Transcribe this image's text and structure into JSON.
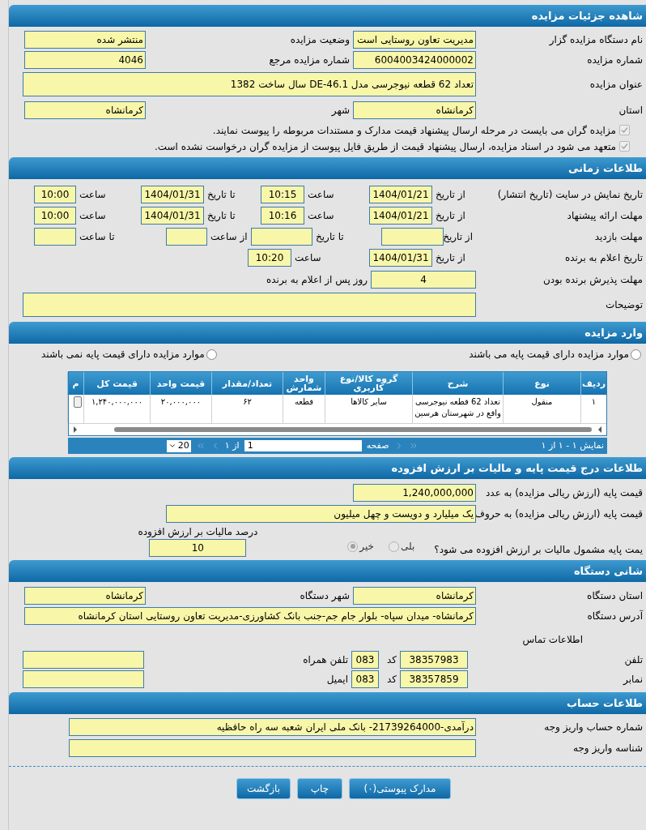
{
  "details": {
    "title": "شاهده جزئیات مزایده",
    "pairs": [
      [
        {
          "label": "نام دستگاه مزایده گزار",
          "value": "مدیریت تعاون روستایی است"
        },
        {
          "label": "وضعیت مزایده",
          "value": "منتشر شده"
        }
      ],
      [
        {
          "label": "شماره مزایده",
          "value": "6004003424000002"
        },
        {
          "label": "شماره مزایده مرجع",
          "value": "4046"
        }
      ]
    ],
    "subject": {
      "label": "عنوان مزایده",
      "value": "تعداد 62 قطعه نیوجرسی مدل DE-46.1  سال ساخت 1382"
    },
    "location": [
      {
        "label": "استان",
        "value": "کرمانشاه"
      },
      {
        "label": "شهر",
        "value": "کرمانشاه"
      }
    ],
    "notices": [
      {
        "text": "مزایده گران می بایست در مرحله ارسال پیشنهاد قیمت مدارک و مستندات مربوطه را پیوست نمایند.",
        "checked": true,
        "disabled": true
      },
      {
        "text": "متعهد می شود در اسناد مزایده، ارسال پیشنهاد قیمت از طریق فایل پیوست از مزایده گران درخواست نشده است.",
        "checked": true,
        "disabled": true
      }
    ]
  },
  "timing": {
    "title": "طلاعات زمانی",
    "rows": [
      {
        "label": "تاریخ نمایش در سایت (تاریخ انتشار)",
        "cells": [
          {
            "label": "از تاریخ",
            "value": "1404/01/21"
          },
          {
            "label": "ساعت",
            "value": "10:15"
          },
          {
            "label": "تا تاریخ",
            "value": "1404/01/31"
          },
          {
            "label": "ساعت",
            "value": "10:00"
          }
        ]
      },
      {
        "label": "مهلت ارائه پیشنهاد",
        "cells": [
          {
            "label": "از تاریخ",
            "value": "1404/01/21"
          },
          {
            "label": "ساعت",
            "value": "10:16"
          },
          {
            "label": "تا تاریخ",
            "value": "1404/01/31"
          },
          {
            "label": "ساعت",
            "value": "10:00"
          }
        ]
      },
      {
        "label": "مهلت بازدید",
        "cells": [
          {
            "label": "از تاریخ"
          },
          {
            "label": "تا تاریخ"
          },
          {
            "label": "از ساعت"
          },
          {
            "label": "تا ساعت"
          }
        ]
      },
      {
        "label": "تاریخ اعلام به برنده",
        "cells": [
          {
            "label": "از تاریخ",
            "value": "1404/01/31"
          },
          {
            "label": "ساعت",
            "value": "10:20"
          }
        ]
      }
    ],
    "acceptance": {
      "label": "مهلت پذیرش برنده بودن",
      "value": "4",
      "suffix": "روز پس از اعلام به برنده"
    },
    "notes": {
      "label": "توضیحات"
    }
  },
  "items": {
    "title": "وارد مزایده",
    "filters": [
      {
        "label": "موارد مزایده دارای قیمت پایه می باشند",
        "selected": false
      },
      {
        "label": "موارد مزایده دارای قیمت پایه نمی باشند",
        "selected": false
      }
    ],
    "table": {
      "columns": [
        "ردیف",
        "نوع",
        "شرح",
        "گروه کالا/نوع کاربری",
        "واحد شمارش",
        "تعداد/مقدار",
        "قیمت واحد",
        "قیمت کل",
        "م"
      ],
      "rows": [
        [
          "١",
          "منقول",
          "تعداد 62 قطعه نیوجرسی واقع در شهرستان هرسین",
          "سایر کالاها",
          "قطعه",
          "۶۲",
          "۲۰,۰۰۰,۰۰۰",
          "۱,۲۴۰,۰۰۰,۰۰۰"
        ]
      ]
    },
    "pager": {
      "summary": "نمایش ١ - ١ از ١",
      "page_label": "صفحه",
      "page": "1",
      "of": "از ١",
      "page_size": "20"
    }
  },
  "pricing": {
    "title": "طلاعات درج قیمت پایه و مالیات بر ارزش افزوده",
    "rows": [
      {
        "label": "قیمت پایه (ارزش ریالی مزایده) به عدد",
        "value": "1,240,000,000"
      },
      {
        "label": "قیمت پایه (ارزش ریالی مزایده) به حروف",
        "value": "یک میلیارد و دویست و چهل میلیون"
      }
    ],
    "vat_question": "یمت پایه مشمول مالیات بر ارزش افزوده می شود؟",
    "vat_options": [
      {
        "label": "بلی",
        "selected": false,
        "disabled": true
      },
      {
        "label": "خیر",
        "selected": true,
        "disabled": true
      }
    ],
    "vat_percent": {
      "label": "درصد مالیات بر ارزش افزوده",
      "value": "10"
    }
  },
  "device": {
    "title": "شانی دستگاه",
    "location": [
      {
        "label": "استان دستگاه",
        "value": "کرمانشاه"
      },
      {
        "label": "شهر دستگاه",
        "value": "کرمانشاه"
      }
    ],
    "address": {
      "label": "آدرس دستگاه",
      "value": "کرمانشاه- میدان سپاه- بلوار جام جم-جنب بانک کشاورزی-مدیریت تعاون روستایی استان کرمانشاه"
    },
    "contact_title": "اطلاعات تماس",
    "contacts": [
      {
        "label": "تلفن",
        "value": "38357983",
        "code_label": "کد",
        "code": "083",
        "other_label": "تلفن همراه"
      },
      {
        "label": "نمابر",
        "value": "38357859",
        "code_label": "کد",
        "code": "083",
        "other_label": "ایمیل"
      }
    ]
  },
  "account": {
    "title": "طلاعات حساب",
    "rows": [
      {
        "label": "شماره حساب واریز وجه",
        "value": "درآمدی-2173926400‎0- بانک ملی ایران شعبه سه راه حافظیه"
      },
      {
        "label": "شناسه واریز وجه"
      }
    ]
  },
  "buttons": [
    "مدارک پیوستی(٠)",
    "چاپ",
    "بازگشت"
  ]
}
